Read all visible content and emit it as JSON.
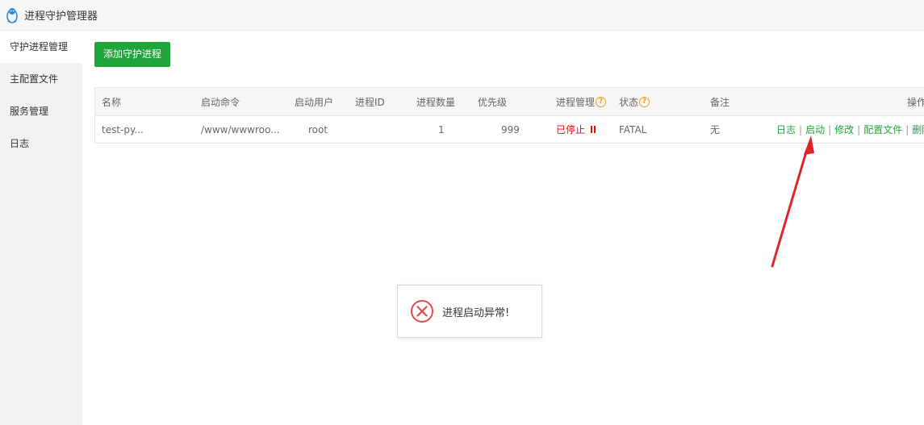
{
  "window": {
    "title": "进程守护管理器",
    "logo_icon": "penguin-icon"
  },
  "sidebar": {
    "items": [
      {
        "label": "守护进程管理",
        "active": true
      },
      {
        "label": "主配置文件",
        "active": false
      },
      {
        "label": "服务管理",
        "active": false
      },
      {
        "label": "日志",
        "active": false
      }
    ]
  },
  "toolbar": {
    "add_label": "添加守护进程"
  },
  "table": {
    "headers": {
      "name": "名称",
      "command": "启动命令",
      "user": "启动用户",
      "pid": "进程ID",
      "count": "进程数量",
      "priority": "优先级",
      "manage": "进程管理",
      "status": "状态",
      "remark": "备注",
      "ops": "操作"
    },
    "rows": [
      {
        "name": "test-py...",
        "command": "/www/wwwroo...",
        "user": "root",
        "pid": "",
        "count": "1",
        "priority": "999",
        "manage": "已停止",
        "status": "FATAL",
        "remark": "无",
        "ops": [
          "日志",
          "启动",
          "修改",
          "配置文件",
          "删除"
        ]
      }
    ]
  },
  "toast": {
    "message": "进程启动异常!",
    "icon": "error-circle-icon"
  },
  "colors": {
    "accent": "#20a53a",
    "danger": "#ff0000",
    "warning": "#f0a020",
    "arrow": "#e0242b"
  }
}
